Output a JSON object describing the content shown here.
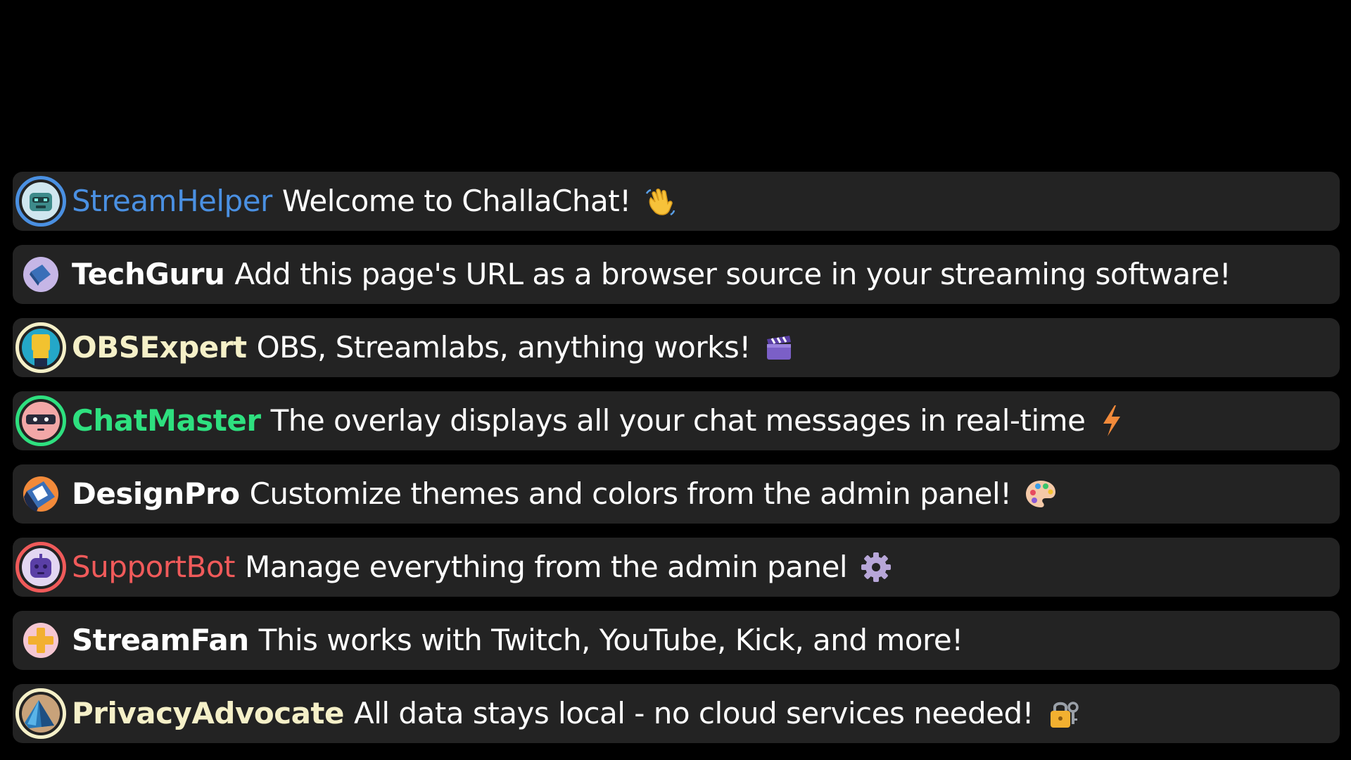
{
  "messages": [
    {
      "username": "StreamHelper",
      "text": "Welcome to ChallaChat!",
      "name_color": "#4a90e2",
      "ring_color": "#4a90e2",
      "emoji": "waving-hand-icon"
    },
    {
      "username": "TechGuru",
      "text": "Add this page's URL as a browser source in your streaming software!",
      "name_color": "#ffffff",
      "ring_color": "",
      "emoji": ""
    },
    {
      "username": "OBSExpert",
      "text": "OBS, Streamlabs, anything works!",
      "name_color": "#f5f0c8",
      "ring_color": "#f5f0c8",
      "emoji": "clapper-board-icon"
    },
    {
      "username": "ChatMaster",
      "text": "The overlay displays all your chat messages in real-time",
      "name_color": "#2ee07f",
      "ring_color": "#2ee07f",
      "emoji": "lightning-icon"
    },
    {
      "username": "DesignPro",
      "text": "Customize themes and colors from the admin panel!",
      "name_color": "#ffffff",
      "ring_color": "",
      "emoji": "palette-icon"
    },
    {
      "username": "SupportBot",
      "text": "Manage everything from the admin panel",
      "name_color": "#f05a5a",
      "ring_color": "#f05a5a",
      "emoji": "gear-icon"
    },
    {
      "username": "StreamFan",
      "text": "This works with Twitch, YouTube, Kick, and more!",
      "name_color": "#ffffff",
      "ring_color": "",
      "emoji": ""
    },
    {
      "username": "PrivacyAdvocate",
      "text": "All data stays local - no cloud services needed!",
      "name_color": "#f5f0c8",
      "ring_color": "#f5f0c8",
      "emoji": "lock-with-key-icon"
    }
  ]
}
